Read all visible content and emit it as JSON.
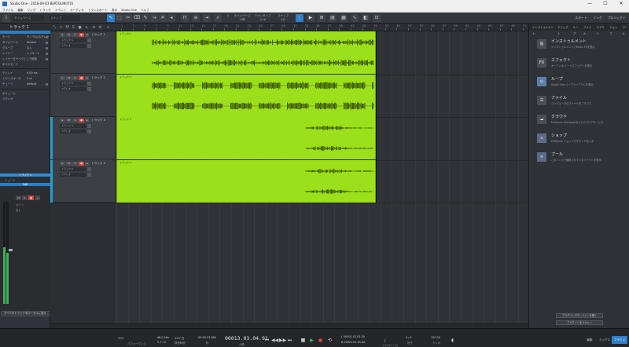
{
  "window": {
    "title": "Studio One - 2018-09-03 BERTOLINI(TO)",
    "controls": [
      "—",
      "☐",
      "✕"
    ]
  },
  "menu": [
    "ファイル",
    "編集",
    "ソング",
    "トラック",
    "イベント",
    "オーディオ",
    "トランスポート",
    "表示",
    "Studio One",
    "ヘルプ"
  ],
  "toolbar": {
    "timebase_label": "タイムベース",
    "timebase_value": "小節",
    "snap_label": "スナップ",
    "snap_value": "4分",
    "quantize_label": "クオンタイズ",
    "quantize_value": "1/16",
    "snap2_label": "スナップ",
    "snap2_value": "4分",
    "grid_label": "Q",
    "right_buttons": [
      "スタート",
      "ソング",
      "プロジェクト"
    ]
  },
  "inspector": {
    "header": "トラック 1",
    "rows": [
      {
        "k": "モード",
        "v": "モノラル/ステレオ"
      },
      {
        "k": "タイムベース",
        "v": "Stretch"
      },
      {
        "k": "グループ",
        "v": "なし"
      },
      {
        "k": "レイヤー",
        "v": "レイヤー1"
      },
      {
        "k": "レイヤーをテイクとして使用",
        "v": ""
      },
      {
        "k": "ボイスモード",
        "v": ""
      },
      {
        "k": "ディレイ",
        "v": "0.00 ms"
      },
      {
        "k": "トランスポーズ",
        "v": "0 st"
      },
      {
        "k": "チューン",
        "v": "Default"
      },
      {
        "k": "ボリューム",
        "v": ""
      },
      {
        "k": "ステレオ",
        "v": ""
      }
    ],
    "channel_name": "トラック 1",
    "channel_sub": "ミュート",
    "channel_value": "0dB",
    "strip_label_1": "メイン",
    "strip_label_2": "なし",
    "footer": "すべてのトラックをローカルに表示"
  },
  "tracks": [
    {
      "name": "トラック 1",
      "lane1": "トラック 1",
      "lane2": "ステレオ"
    },
    {
      "name": "トラック 2",
      "lane1": "トラック 2",
      "lane2": "ステレオ"
    },
    {
      "name": "トラック 3",
      "lane1": "トラック 3",
      "lane2": "ステレオ"
    },
    {
      "name": "トラック 4",
      "lane1": "トラック 4",
      "lane2": "ステレオ"
    }
  ],
  "clips": [
    "トラック 1",
    "トラック 2",
    "トラック 3",
    "トラック 4"
  ],
  "ruler_ticks": [
    "1",
    "3",
    "5",
    "7",
    "9",
    "11",
    "13",
    "15",
    "17",
    "19",
    "21",
    "23",
    "25",
    "27",
    "29",
    "31",
    "33",
    "35",
    "37",
    "39",
    "41",
    "43",
    "45",
    "47",
    "49",
    "51",
    "53",
    "55",
    "57",
    "59",
    "61",
    "63",
    "65",
    "67",
    "69",
    "71"
  ],
  "browser": {
    "tabs": [
      "インストゥルメント",
      "エフェクト",
      "ループ",
      "ファイル",
      "クラウド",
      "ショップ",
      "プール"
    ],
    "items": [
      {
        "icon": "▥",
        "title": "インストゥルメント",
        "desc": "インストゥルメントとMusic FXを表示"
      },
      {
        "icon": "FX",
        "title": "エフェクト",
        "desc": "オーディオ/ノートエフェクトを表示"
      },
      {
        "icon": "◎",
        "title": "ループ",
        "desc": "Studio One ループライブラリを表示"
      },
      {
        "icon": "☰",
        "title": "ファイル",
        "desc": "コンピュータのファイルをブラウズ"
      },
      {
        "icon": "☁",
        "title": "クラウド",
        "desc": "PreSonus Exchangeなどのクラウドサービス"
      },
      {
        "icon": "⌂",
        "title": "ショップ",
        "desc": "PreSonus ショップでサウンドを入手"
      },
      {
        "icon": "≋",
        "title": "プール",
        "desc": "このソングで使用されているファイルを表示"
      }
    ],
    "buttons": [
      "プラグインマネージャーを開く",
      "プラグインをスキャン"
    ]
  },
  "transport": {
    "midi": "MIDI",
    "performance": "パフォーマンス",
    "sample_rate": "48.0 kHz",
    "latency": "6.6 ms",
    "record_time": "1:07 日",
    "record_label": "録音時間",
    "time_sec": "00:00:23.384",
    "time_label": "秒",
    "position": "00013.03.04.91",
    "position_label": "小節",
    "loop_l": "L  00001.01.01.00",
    "loop_r": "R  00021.01.01.00",
    "signature": "4 / 4",
    "tempo": "120.00",
    "tempo_label": "テンポ",
    "metro": "メトロノーム",
    "timesig_label": "拍子",
    "tabs": [
      "編集",
      "ミックス",
      "ブラウズ"
    ]
  }
}
